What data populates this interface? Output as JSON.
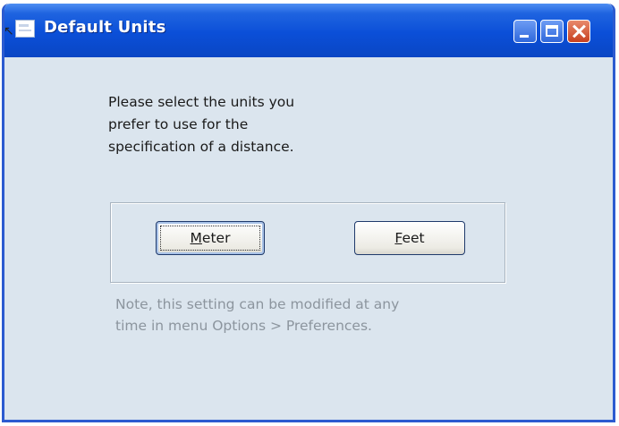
{
  "window": {
    "title": "Default Units",
    "icon": "document-icon",
    "controls": {
      "minimize": "minimize-icon",
      "maximize": "maximize-icon",
      "close": "close-icon"
    }
  },
  "dialog": {
    "prompt_lines": [
      "Please select the units you",
      "prefer to use for the",
      "specification of a distance."
    ],
    "buttons": {
      "meter": {
        "mnemonic": "M",
        "rest": "eter",
        "label": "Meter",
        "focused": true
      },
      "feet": {
        "mnemonic": "F",
        "rest": "eet",
        "label": "Feet",
        "focused": false
      }
    },
    "note_lines": [
      "Note, this setting can be modified at any",
      "time in menu Options > Preferences."
    ]
  },
  "colors": {
    "titlebar": "#0b4fd8",
    "dialog_background": "#dbe5ee",
    "note_text": "#8c959e",
    "close_button": "#c8401f"
  }
}
